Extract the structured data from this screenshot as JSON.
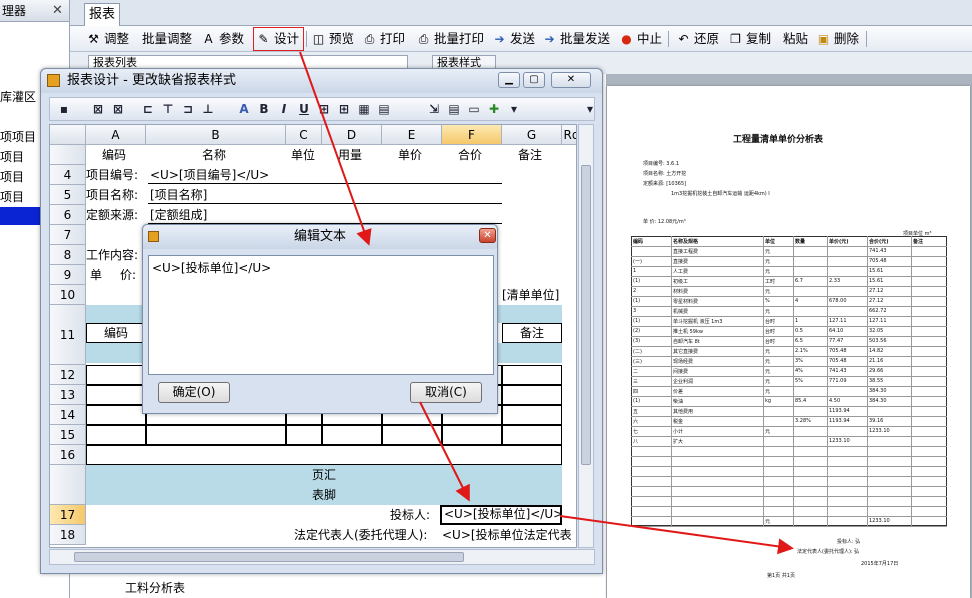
{
  "left_panel": {
    "header": "理器",
    "items": [
      "库灌区",
      "项项目",
      "项目",
      "项目",
      "项目"
    ]
  },
  "tab": {
    "label": "报表"
  },
  "toolbar": {
    "items": [
      {
        "label": "调整",
        "icon": "adjust-icon"
      },
      {
        "label": "批量调整",
        "icon": "batch-adjust-icon"
      },
      {
        "label": "参数",
        "icon": "params-icon"
      },
      {
        "label": "设计",
        "icon": "pencil-icon"
      },
      {
        "label": "预览",
        "icon": "preview-icon"
      },
      {
        "label": "打印",
        "icon": "printer-icon"
      },
      {
        "label": "批量打印",
        "icon": "batch-print-icon"
      },
      {
        "label": "发送",
        "icon": "arrow-right-icon"
      },
      {
        "label": "批量发送",
        "icon": "double-arrow-icon"
      },
      {
        "label": "中止",
        "icon": "stop-icon"
      },
      {
        "label": "还原",
        "icon": "restore-icon"
      },
      {
        "label": "复制",
        "icon": "copy-icon"
      },
      {
        "label": "粘贴",
        "icon": "paste-icon"
      },
      {
        "label": "删除",
        "icon": "delete-icon"
      }
    ]
  },
  "row2": {
    "left": "报表列表",
    "right": "报表样式"
  },
  "design_dialog": {
    "title": "报表设计 - 更改缺省报表样式",
    "columns": [
      "A",
      "B",
      "C",
      "D",
      "E",
      "F",
      "G",
      "Rd"
    ],
    "rows": [
      "4",
      "5",
      "6",
      "7",
      "8",
      "9",
      "10",
      "11",
      "12",
      "13",
      "14",
      "15",
      "16",
      "17",
      "18"
    ],
    "header_cells": [
      "编码",
      "名称",
      "单位",
      "用量",
      "单价",
      "合价",
      "备注"
    ],
    "r4": "项目编号:",
    "r4b": "<U>[项目编号]</U>",
    "r5": "项目名称:",
    "r5b": "[项目名称]",
    "r6": "定额来源:",
    "r6b": "[定额组成]",
    "r8": "工作内容:",
    "r9a": "单",
    "r9b": "价:",
    "r10_right": "[清单单位]",
    "r11a": "编码",
    "r11g": "备注",
    "band_subtotal": "页汇",
    "band_footer": "表脚",
    "r17_label": "投标人:",
    "r17_value": "<U>[投标单位]</U>",
    "r18_label": "法定代表人(委托代理人):",
    "r18_value": "<U>[投标单位法定代表"
  },
  "edit_dialog": {
    "title": "编辑文本",
    "text": "<U>[投标单位]</U>",
    "ok": "确定(O)",
    "cancel": "取消(C)"
  },
  "preview": {
    "title": "工程量清单单价分析表",
    "meta": [
      "项目编号:  3.6.1",
      "项目名称:  土方开挖",
      "定额来源:  [10365]",
      "单    价:  12.08元/m³"
    ],
    "meta_note": "1m3挖掘机挖装土自卸汽车运输  运距4km) I",
    "unit_label": "项目单位  m³",
    "headers": [
      "编码",
      "名称及规格",
      "单位",
      "数量",
      "单价(元)",
      "合价(元)",
      "备注"
    ],
    "rows": [
      [
        "",
        "直接工程费",
        "元",
        "",
        "",
        "741.43",
        ""
      ],
      [
        "(一)",
        "直接费",
        "元",
        "",
        "",
        "705.48",
        ""
      ],
      [
        "1",
        "人工费",
        "元",
        "",
        "",
        "15.61",
        ""
      ],
      [
        "(1)",
        "初级工",
        "工时",
        "6.7",
        "2.33",
        "15.61",
        ""
      ],
      [
        "2",
        "材料费",
        "元",
        "",
        "",
        "27.12",
        ""
      ],
      [
        "(1)",
        "零星材料费",
        "%",
        "4",
        "678.00",
        "27.12",
        ""
      ],
      [
        "3",
        "机械费",
        "元",
        "",
        "",
        "662.72",
        ""
      ],
      [
        "(1)",
        "单斗挖掘机 液压 1m3",
        "台时",
        "1",
        "127.11",
        "127.11",
        ""
      ],
      [
        "(2)",
        "推土机 59kw",
        "台时",
        "0.5",
        "64.10",
        "32.05",
        ""
      ],
      [
        "(3)",
        "自卸汽车 8t",
        "台时",
        "6.5",
        "77.47",
        "503.56",
        ""
      ],
      [
        "(二)",
        "其它直接费",
        "元",
        "2.1%",
        "705.48",
        "14.82",
        ""
      ],
      [
        "(三)",
        "现场经费",
        "元",
        "3%",
        "705.48",
        "21.16",
        ""
      ],
      [
        "二",
        "间接费",
        "元",
        "4%",
        "741.43",
        "29.66",
        ""
      ],
      [
        "三",
        "企业利润",
        "元",
        "5%",
        "771.09",
        "38.55",
        ""
      ],
      [
        "四",
        "价差",
        "元",
        "",
        "",
        "384.30",
        ""
      ],
      [
        "(1)",
        "柴油",
        "kg",
        "85.4",
        "4.50",
        "384.30",
        ""
      ],
      [
        "五",
        "其他费用",
        "",
        "",
        "1193.94",
        "",
        ""
      ],
      [
        "六",
        "税金",
        "",
        "3.28%",
        "1193.94",
        "39.16",
        ""
      ],
      [
        "七",
        "小计",
        "元",
        "",
        "",
        "1233.10",
        ""
      ],
      [
        "八",
        "扩大",
        "",
        "",
        "1233.10",
        "",
        ""
      ]
    ],
    "total_row": [
      "",
      "",
      "元",
      "",
      "",
      "1233.10",
      ""
    ],
    "footer_bidder": "投标人: 弘",
    "footer_rep": "法定代表人(委托代理人): 弘",
    "footer_date": "2015年7月17日",
    "page_no": "第1页 共1页"
  },
  "bottom_item": "工料分析表"
}
